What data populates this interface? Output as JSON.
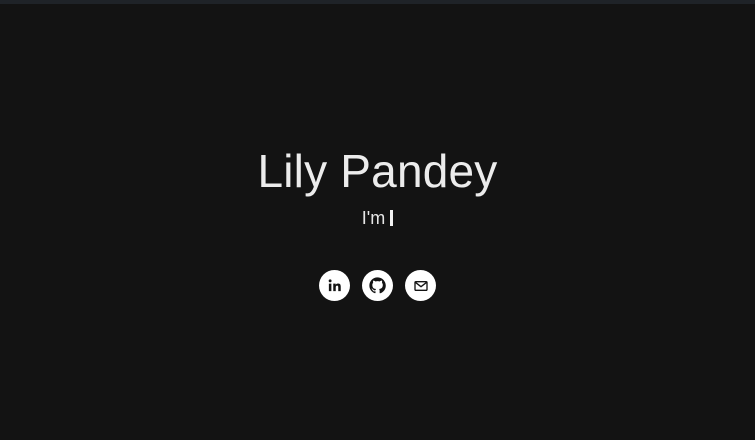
{
  "header": {
    "name": "Lily Pandey",
    "tagline_prefix": "I'm"
  },
  "socials": [
    {
      "icon": "linkedin-icon",
      "label": "in"
    },
    {
      "icon": "github-icon"
    },
    {
      "icon": "mail-icon"
    }
  ],
  "colors": {
    "background": "#131313",
    "top_bar": "#1f2328",
    "text": "#ececec",
    "icon_bg": "#ffffff",
    "icon_fg": "#131313"
  }
}
